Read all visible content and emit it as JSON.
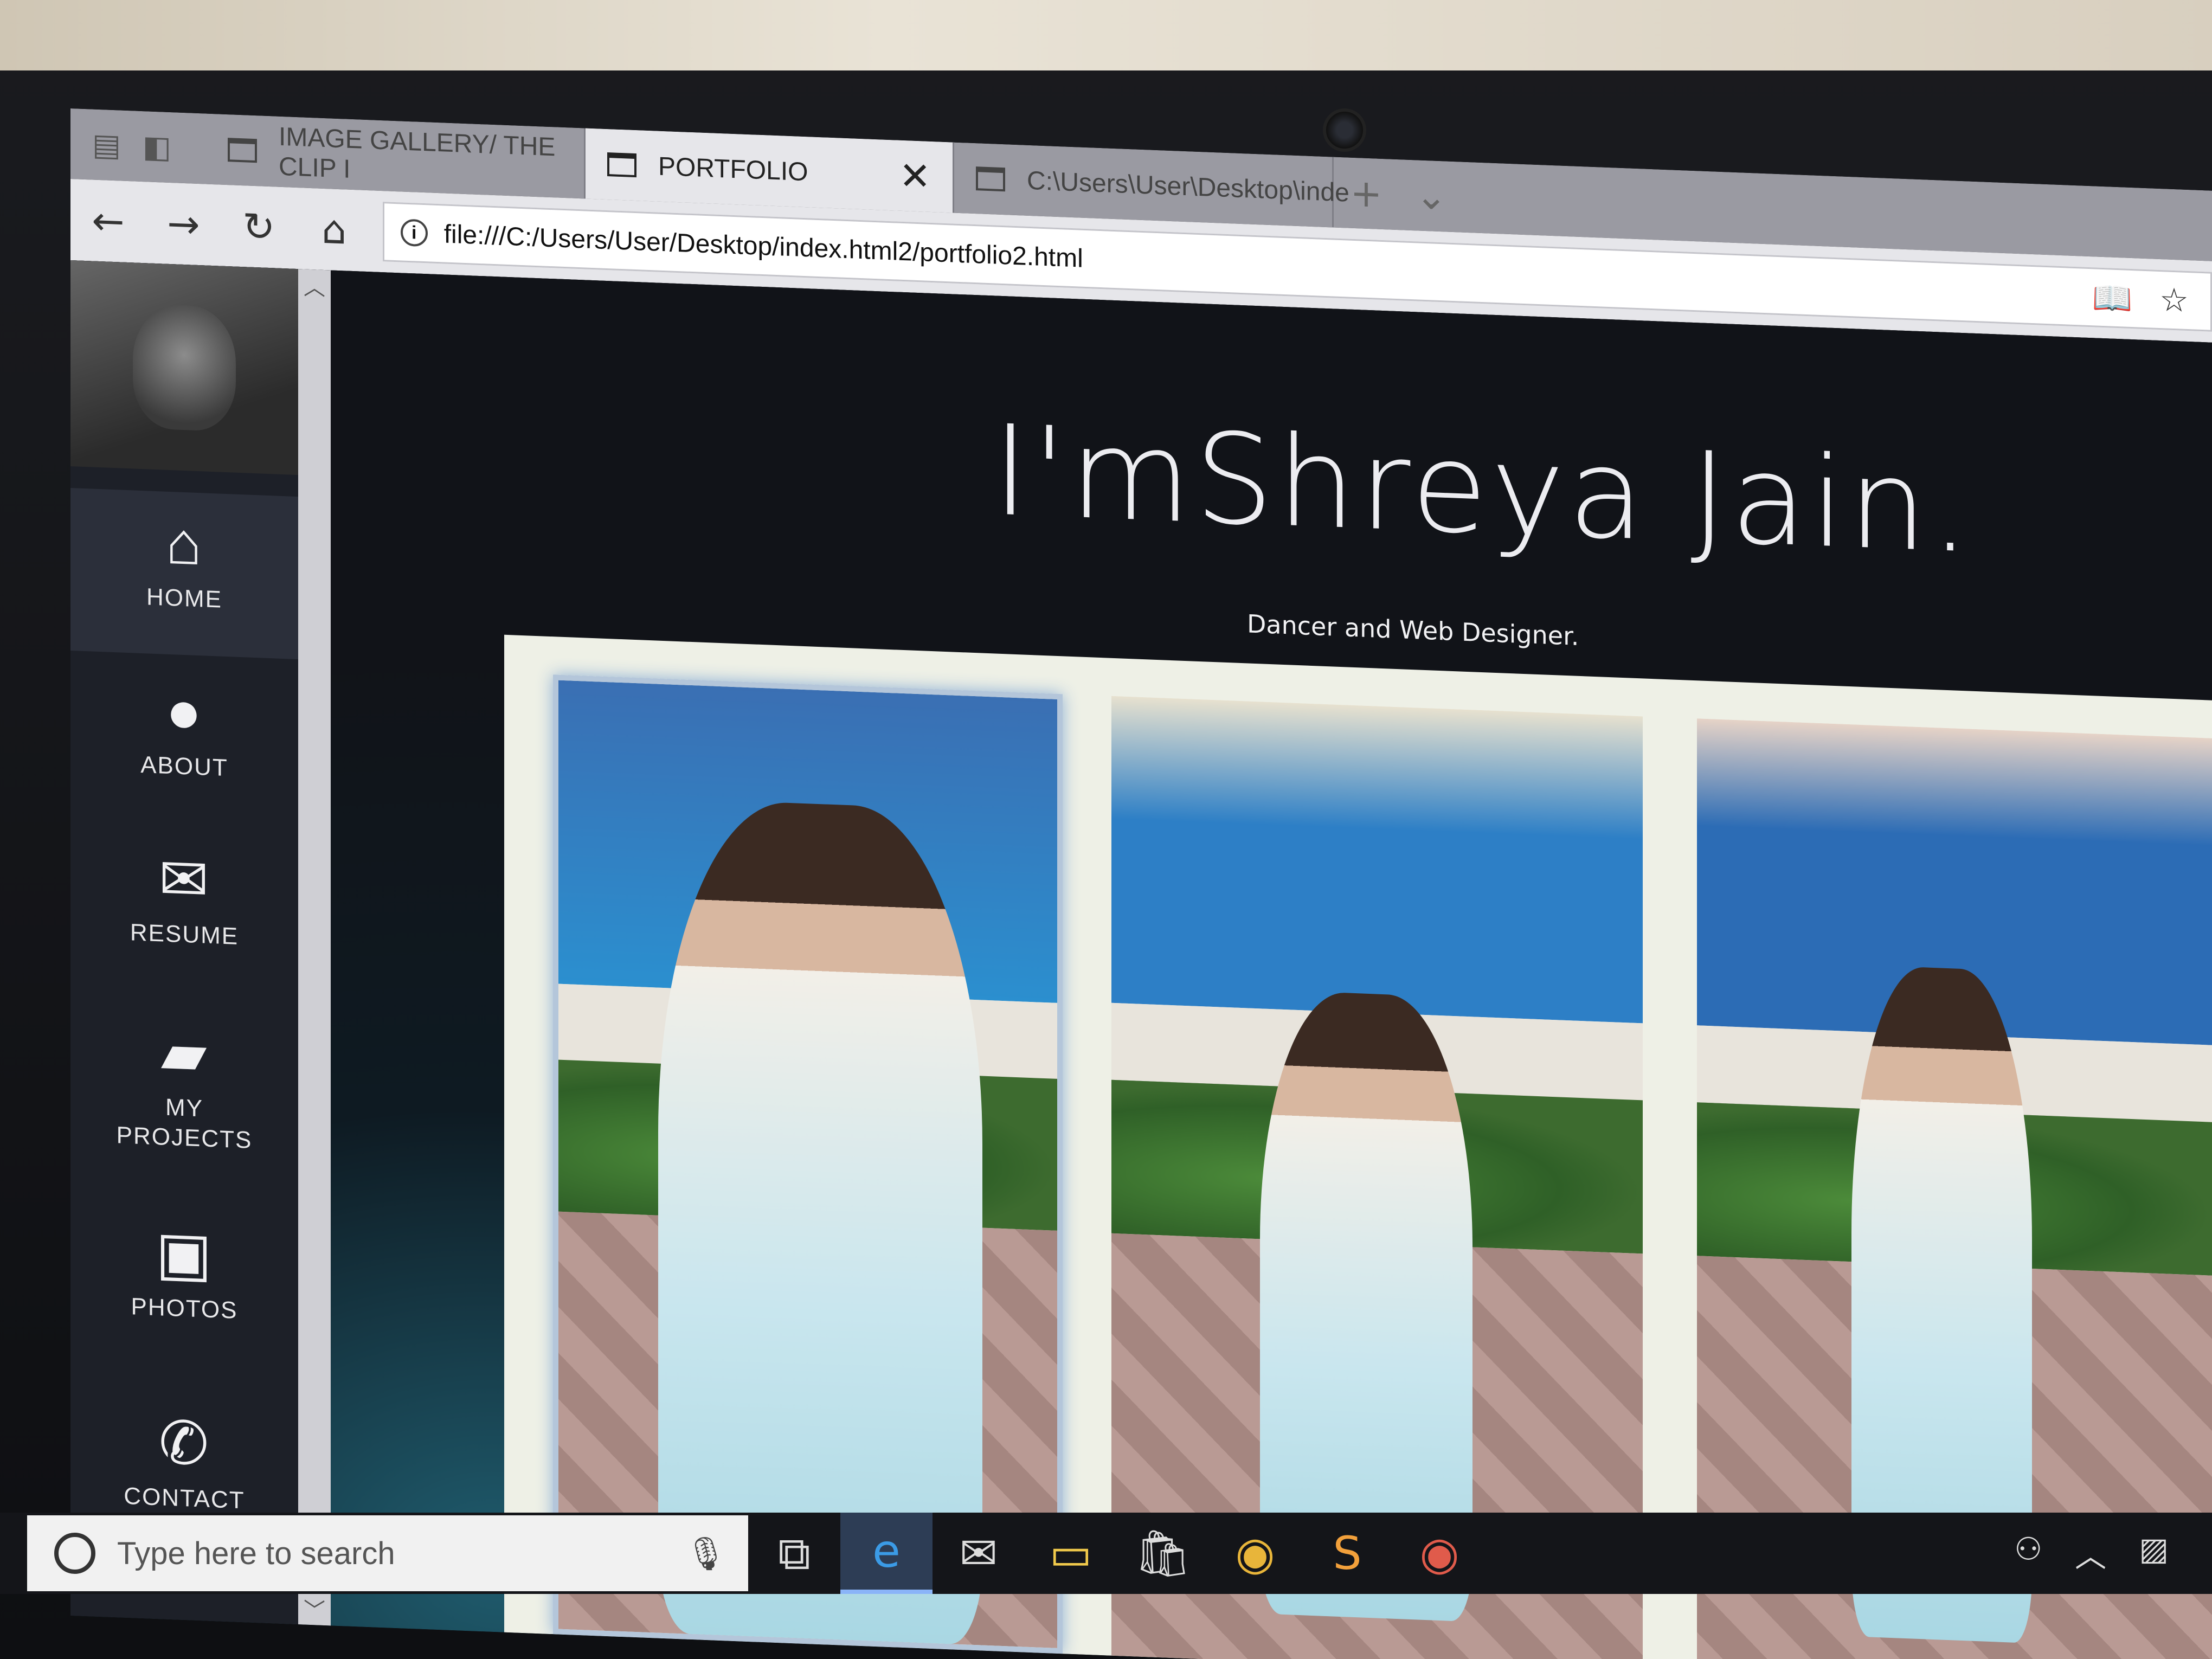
{
  "browser": {
    "tabs": [
      {
        "label": "IMAGE GALLERY/ THE CLIP I"
      },
      {
        "label": "PORTFOLIO"
      },
      {
        "label": "C:\\Users\\User\\Desktop\\inde"
      }
    ],
    "url": "file:///C:/Users/User/Desktop/index.html2/portfolio2.html"
  },
  "sidebar": {
    "items": [
      {
        "label": "HOME",
        "icon": "home-icon"
      },
      {
        "label": "ABOUT",
        "icon": "user-icon"
      },
      {
        "label": "RESUME",
        "icon": "envelope-icon"
      },
      {
        "label": "MY PROJECTS",
        "icon": "folder-icon"
      },
      {
        "label": "PHOTOS",
        "icon": "photo-icon"
      },
      {
        "label": "CONTACT",
        "icon": "phone-icon"
      }
    ]
  },
  "hero": {
    "title": "I'mShreya Jain.",
    "subtitle": "Dancer and Web Designer."
  },
  "taskbar": {
    "search_placeholder": "Type here to search"
  },
  "colors": {
    "sidebar": "#1d2028",
    "page_bg": "#111318",
    "gallery_bg": "#eef0e6",
    "tab_active": "#e6e6ea"
  }
}
